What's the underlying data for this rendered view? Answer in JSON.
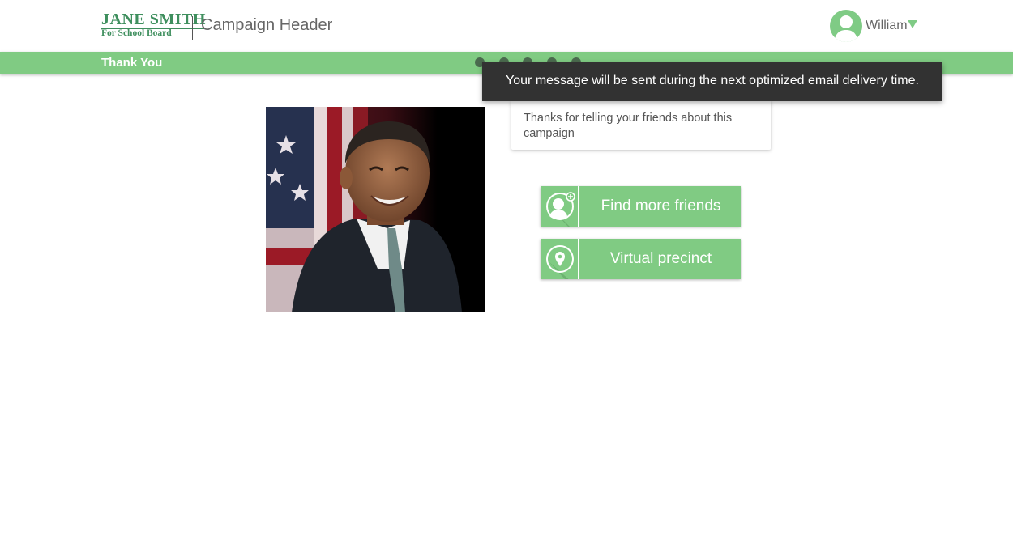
{
  "header": {
    "logo_line1": "JANE SMITH",
    "logo_line2": "For School Board",
    "campaign_title": "Campaign Header",
    "user_name": "William"
  },
  "progress": {
    "step_label": "Thank You",
    "total_steps": 5
  },
  "toast": {
    "message": "Your message will be sent during the next optimized email delivery time."
  },
  "thanks_card": {
    "text": "Thanks for telling your friends about this campaign"
  },
  "actions": [
    {
      "label": "Find more friends",
      "icon": "add-friend-icon"
    },
    {
      "label": "Virtual precinct",
      "icon": "map-pin-icon"
    }
  ],
  "colors": {
    "accent_green": "#80cb83",
    "logo_green": "#3f8f5e",
    "toast_bg": "#323232",
    "step_dot": "#4b6b4f"
  }
}
